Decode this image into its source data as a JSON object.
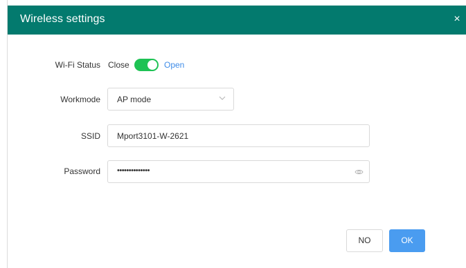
{
  "dialog": {
    "title": "Wireless settings",
    "close_glyph": "×"
  },
  "form": {
    "wifi_status": {
      "label": "Wi-Fi Status",
      "off_label": "Close",
      "on_label": "Open",
      "enabled": true,
      "toggle_color": "#1ec254"
    },
    "workmode": {
      "label": "Workmode",
      "value": "AP mode",
      "icon": "chevron-down-icon"
    },
    "ssid": {
      "label": "SSID",
      "value": "Mport3101-W-2621"
    },
    "password": {
      "label": "Password",
      "masked_value": "••••••••••••••",
      "icon": "eye-icon"
    }
  },
  "buttons": {
    "no_label": "NO",
    "ok_label": "OK"
  },
  "colors": {
    "header": "#037a6e",
    "accent_link": "#3e8ce8",
    "primary_button": "#4a9cf0"
  }
}
